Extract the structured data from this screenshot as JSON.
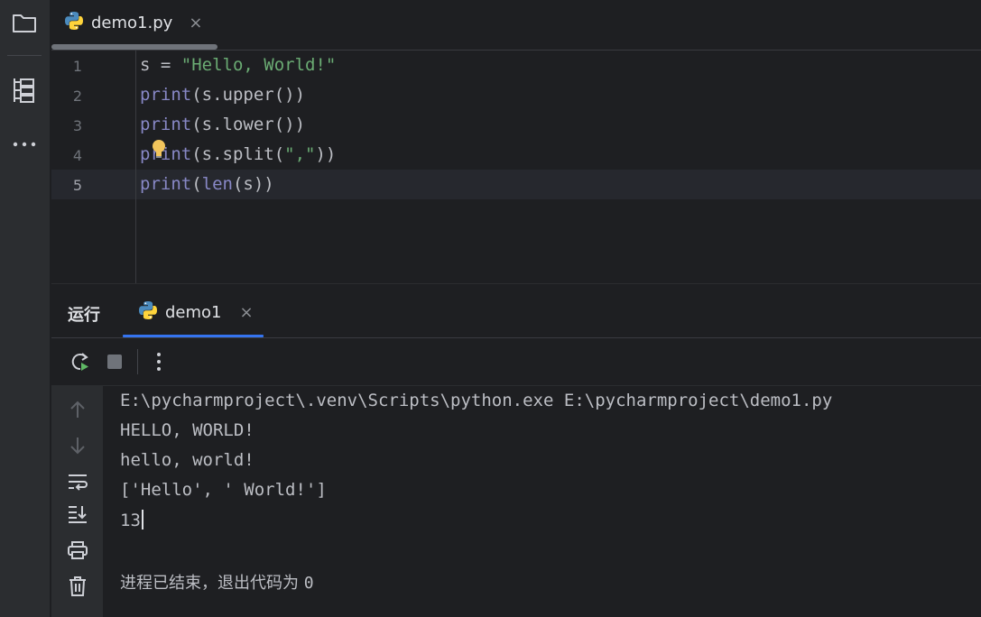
{
  "activity_bar": {
    "items": [
      {
        "icon": "folder-icon"
      },
      {
        "icon": "structure-icon"
      },
      {
        "icon": "more-horizontal-icon"
      }
    ]
  },
  "editor_tab": {
    "label": "demo1.py",
    "close": "×",
    "icon": "python-icon"
  },
  "editor": {
    "lines": [
      {
        "number": "1"
      },
      {
        "number": "2"
      },
      {
        "number": "3"
      },
      {
        "number": "4"
      },
      {
        "number": "5"
      }
    ],
    "code": {
      "l1_var": "s = ",
      "l1_str": "\"Hello, World!\"",
      "l2_kw": "print",
      "l2_rest": "(s.upper())",
      "l3_kw": "print",
      "l3_rest": "(s.lower())",
      "l4_kw": "print",
      "l4_rest1": "(s.split(",
      "l4_str": "\",\"",
      "l4_rest2": "))",
      "l5_kw": "print",
      "l5_paren": "(",
      "l5_kw2": "len",
      "l5_rest": "(s))"
    },
    "current_line": "5"
  },
  "run_panel": {
    "title": "运行",
    "tab_label": "demo1",
    "tab_close": "×",
    "output": {
      "command": "E:\\pycharmproject\\.venv\\Scripts\\python.exe E:\\pycharmproject\\demo1.py",
      "line1": "HELLO, WORLD!",
      "line2": "hello, world!",
      "line3": "['Hello', ' World!']",
      "line4": "13",
      "exit_text": "进程已结束，退出代码为 ",
      "exit_code": "0"
    }
  },
  "colors": {
    "accent": "#3574f0",
    "keyword": "#8888c6",
    "string": "#6aab73",
    "background": "#1e1f22",
    "panel": "#2b2d30"
  }
}
